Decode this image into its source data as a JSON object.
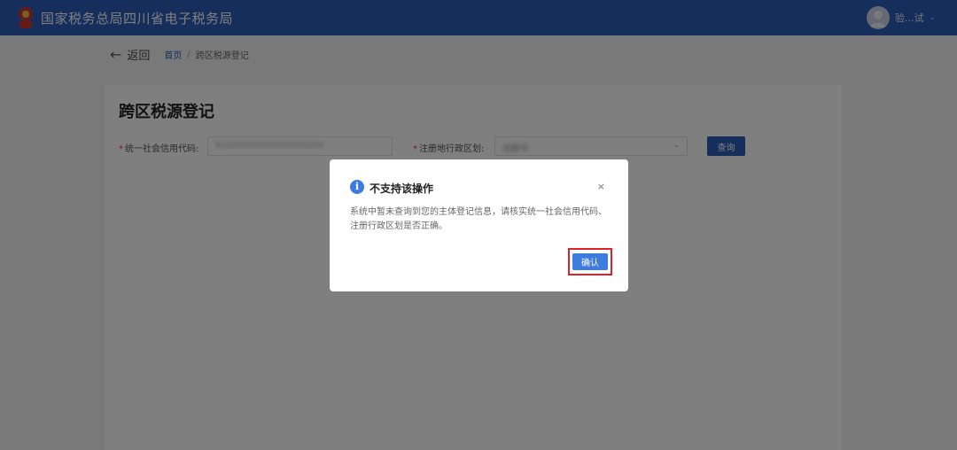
{
  "header": {
    "site_title": "国家税务总局四川省电子税务局",
    "user_name": "验...试",
    "logo_icon": "tax-emblem-icon",
    "color": "#2b5cb8"
  },
  "nav": {
    "back_label": "返回",
    "breadcrumb_home": "首页",
    "breadcrumb_separator": "/",
    "breadcrumb_current": "跨区税源登记"
  },
  "page": {
    "title": "跨区税源登记",
    "fields": {
      "credit_code_label": "统一社会信用代码:",
      "credit_code_value": "91XXXXXXXXXXXXXXXX",
      "region_label": "注册地行政区划:",
      "region_value": "成都市"
    },
    "query_button": "查询"
  },
  "modal": {
    "title": "不支持该操作",
    "body": "系统中暂未查询到您的主体登记信息，请核实统一社会信用代码、注册行政区划是否正确。",
    "close_symbol": "×",
    "confirm_button": "确认",
    "info_symbol": "i",
    "accent_color": "#3e7be0",
    "highlight_color": "#e0202a"
  }
}
